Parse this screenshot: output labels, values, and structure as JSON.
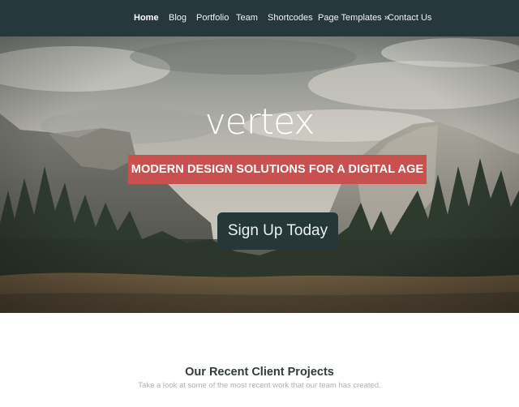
{
  "nav": {
    "items": [
      {
        "label": "Home",
        "active": true
      },
      {
        "label": "Blog"
      },
      {
        "label": "Portfolio"
      },
      {
        "label": "Team"
      },
      {
        "label": "Shortcodes"
      },
      {
        "label": "Page Templates »"
      },
      {
        "label": "Contact Us"
      }
    ]
  },
  "hero": {
    "title": "vertex",
    "tagline": "MODERN DESIGN SOLUTIONS FOR A DIGITAL AGE",
    "cta_label": "Sign Up Today"
  },
  "projects": {
    "title": "Our Recent Client Projects",
    "subtitle": "Take a look at some of the most recent work that our team has created."
  },
  "colors": {
    "nav_bg": "#27383c",
    "accent_red": "#c8514f",
    "button_bg": "#26373a"
  }
}
